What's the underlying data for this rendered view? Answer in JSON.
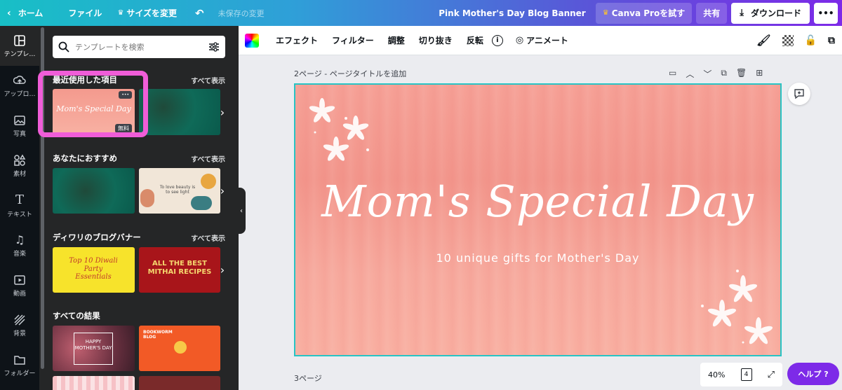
{
  "topbar": {
    "home": "ホーム",
    "file": "ファイル",
    "resize": "サイズを変更",
    "unsaved": "未保存の変更",
    "doc_title": "Pink Mother's Day Blog Banner",
    "pro": "Canva Proを試す",
    "share": "共有",
    "download": "ダウンロード"
  },
  "nav": [
    {
      "label": "テンプレ…",
      "icon": "template-icon"
    },
    {
      "label": "アップロ…",
      "icon": "upload-icon"
    },
    {
      "label": "写真",
      "icon": "photo-icon"
    },
    {
      "label": "素材",
      "icon": "elements-icon"
    },
    {
      "label": "テキスト",
      "icon": "text-icon"
    },
    {
      "label": "音楽",
      "icon": "music-icon"
    },
    {
      "label": "動画",
      "icon": "video-icon"
    },
    {
      "label": "背景",
      "icon": "background-icon"
    },
    {
      "label": "フォルダー",
      "icon": "folder-icon"
    }
  ],
  "panel": {
    "search_placeholder": "テンプレートを検索",
    "sections": [
      {
        "title": "最近使用した項目",
        "all": "すべて表示"
      },
      {
        "title": "あなたにおすすめ",
        "all": "すべて表示"
      },
      {
        "title": "ディワリのブログバナー",
        "all": "すべて表示"
      },
      {
        "title": "すべての結果",
        "all": ""
      }
    ],
    "recent_thumb": {
      "title": "Mom's Special Day",
      "badge": "無料",
      "more": "•••"
    },
    "rec_thumb2_text": "To love beauty is to see light",
    "diwali1_text": "Top 10 Diwali Party Essentials",
    "diwali2_text": "ALL THE BEST MITHAI RECIPES",
    "result1_text": "HAPPY MOTHER'S DAY",
    "result2_text": "BOOKWORM BLOG"
  },
  "toolbar": {
    "effect": "エフェクト",
    "filter": "フィルター",
    "adjust": "調整",
    "crop": "切り抜き",
    "flip": "反転",
    "animate": "アニメート"
  },
  "canvas": {
    "page2_label": "2ページ - ページタイトルを追加",
    "page3_label": "3ページ",
    "title": "Mom's Special Day",
    "subtitle": "10 unique gifts for Mother's Day",
    "zoom": "40%",
    "pages": "4",
    "help": "ヘルプ ?"
  }
}
